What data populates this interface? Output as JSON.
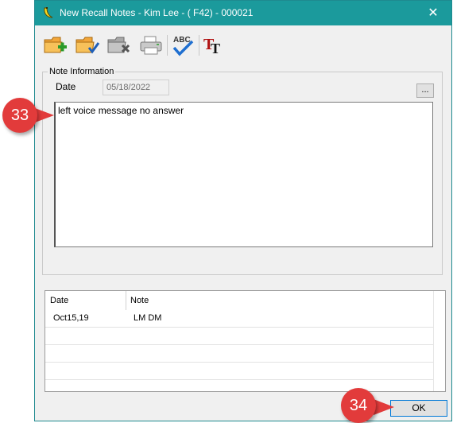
{
  "window": {
    "title": "New Recall Notes - Kim Lee - ( F42) - 000021",
    "title_icon": "banana-icon",
    "close_glyph": "✕"
  },
  "toolbar": {
    "buttons": [
      {
        "name": "new-note-button",
        "icon": "folder-plus-icon"
      },
      {
        "name": "save-note-button",
        "icon": "folder-check-icon"
      },
      {
        "name": "delete-note-button",
        "icon": "folder-delete-icon"
      },
      {
        "name": "print-button",
        "icon": "printer-icon"
      },
      {
        "name": "spell-check-button",
        "icon": "abc-check-icon"
      },
      {
        "name": "font-button",
        "icon": "font-tt-icon"
      }
    ]
  },
  "note_info": {
    "legend": "Note Information",
    "date_label": "Date",
    "date_value": "05/18/2022",
    "ellipsis": "...",
    "note_text": "left voice message no answer"
  },
  "grid": {
    "columns": [
      "Date",
      "Note"
    ],
    "rows": [
      {
        "date": "Oct15,19",
        "note": "LM DM"
      }
    ]
  },
  "ok_label": "OK",
  "callouts": [
    "33",
    "34"
  ],
  "colors": {
    "titlebar": "#1b9a9c",
    "callout": "#e23b3b",
    "ok_border": "#0078d7"
  }
}
